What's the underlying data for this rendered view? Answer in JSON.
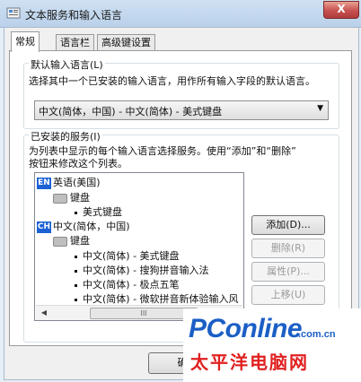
{
  "window": {
    "title": "文本服务和输入语言",
    "close_glyph": "X"
  },
  "tabs": [
    {
      "label": "常规"
    },
    {
      "label": "语言栏"
    },
    {
      "label": "高级键设置"
    }
  ],
  "default_input": {
    "group_label": "默认输入语言(L)",
    "description": "选择其中一个已安装的输入语言，用作所有输入字段的默认语言。",
    "selected": "中文(简体，中国) - 中文(简体) - 美式键盘"
  },
  "installed": {
    "group_label": "已安装的服务(I)",
    "description_line1": "为列表中显示的每个输入语言选择服务。使用“添加”和“删除”",
    "description_line2": "按钮来修改这个列表。",
    "tree": [
      {
        "badge": "EN",
        "label": "英语(美国)"
      },
      {
        "label": "键盘"
      },
      {
        "label": "美式键盘"
      },
      {
        "badge": "CH",
        "label": "中文(简体，中国)"
      },
      {
        "label": "键盘"
      },
      {
        "label": "中文(简体) - 美式键盘"
      },
      {
        "label": "中文(简体) - 搜狗拼音输入法"
      },
      {
        "label": "中文(简体) - 极点五笔"
      },
      {
        "label": "中文(简体) - 微软拼音新体验输入风"
      }
    ],
    "scroll_thumb_grip": "III"
  },
  "buttons": {
    "add": "添加(D)...",
    "remove": "删除(R)",
    "properties": "属性(P)...",
    "move_up": "上移(U)",
    "ok_partial": "确"
  },
  "watermark": {
    "brand": "PConline",
    "suffix": ".com.cn",
    "cn_name": "太平洋电脑网"
  }
}
